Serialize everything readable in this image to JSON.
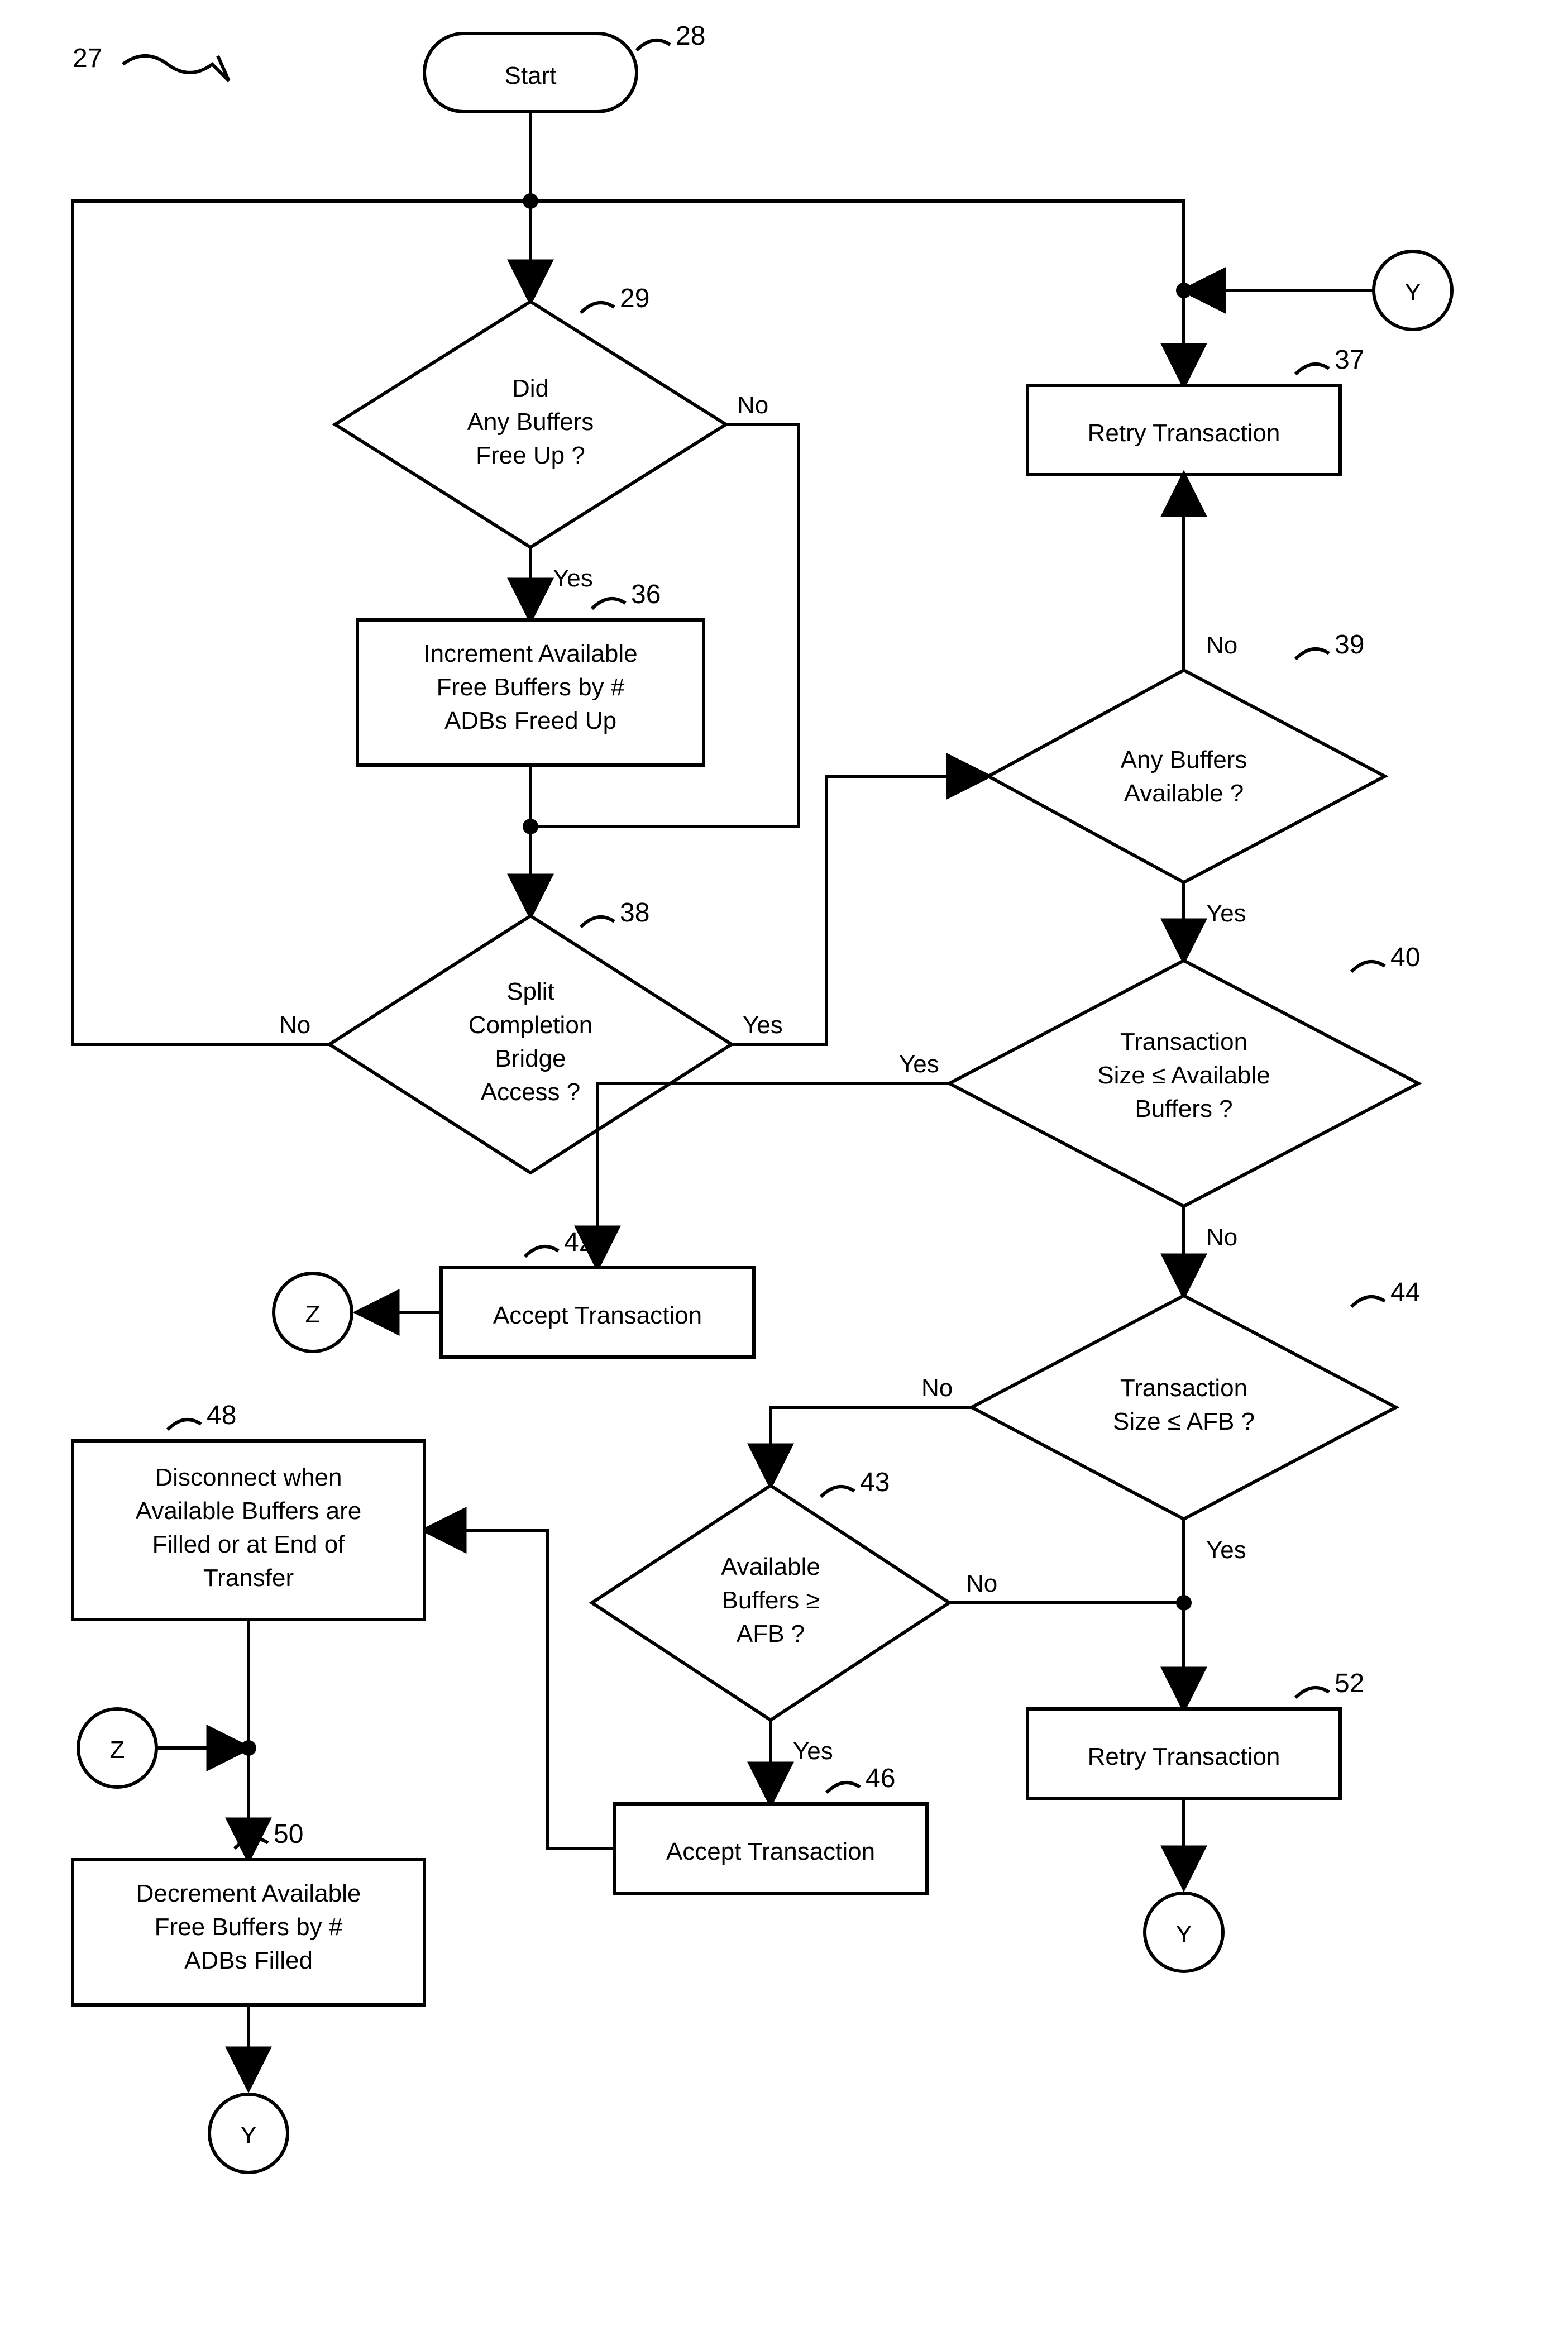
{
  "figure_ref": "27",
  "nodes": {
    "n28": {
      "ref": "28",
      "text": [
        "Start"
      ]
    },
    "n29": {
      "ref": "29",
      "text": [
        "Did",
        "Any Buffers",
        "Free Up ?"
      ],
      "yes": "Yes",
      "no": "No"
    },
    "n36": {
      "ref": "36",
      "text": [
        "Increment Available",
        "Free Buffers by #",
        "ADBs Freed Up"
      ]
    },
    "n37": {
      "ref": "37",
      "text": [
        "Retry Transaction"
      ]
    },
    "n38": {
      "ref": "38",
      "text": [
        "Split",
        "Completion",
        "Bridge",
        "Access ?"
      ],
      "yes": "Yes",
      "no": "No"
    },
    "n39": {
      "ref": "39",
      "text": [
        "Any Buffers",
        "Available ?"
      ],
      "yes": "Yes",
      "no": "No"
    },
    "n40": {
      "ref": "40",
      "text": [
        "Transaction",
        "Size ≤ Available",
        "Buffers ?"
      ],
      "yes": "Yes",
      "no": "No"
    },
    "n42": {
      "ref": "42",
      "text": [
        "Accept Transaction"
      ]
    },
    "n43": {
      "ref": "43",
      "text": [
        "Available",
        "Buffers ≥",
        "AFB ?"
      ],
      "yes": "Yes",
      "no": "No"
    },
    "n44": {
      "ref": "44",
      "text": [
        "Transaction",
        "Size ≤ AFB ?"
      ],
      "yes": "Yes",
      "no": "No"
    },
    "n46": {
      "ref": "46",
      "text": [
        "Accept Transaction"
      ]
    },
    "n48": {
      "ref": "48",
      "text": [
        "Disconnect when",
        "Available Buffers are",
        "Filled or at End of",
        "Transfer"
      ]
    },
    "n50": {
      "ref": "50",
      "text": [
        "Decrement Available",
        "Free Buffers by #",
        "ADBs Filled"
      ]
    },
    "n52": {
      "ref": "52",
      "text": [
        "Retry Transaction"
      ]
    }
  },
  "connectors": {
    "Y": "Y",
    "Z": "Z"
  }
}
